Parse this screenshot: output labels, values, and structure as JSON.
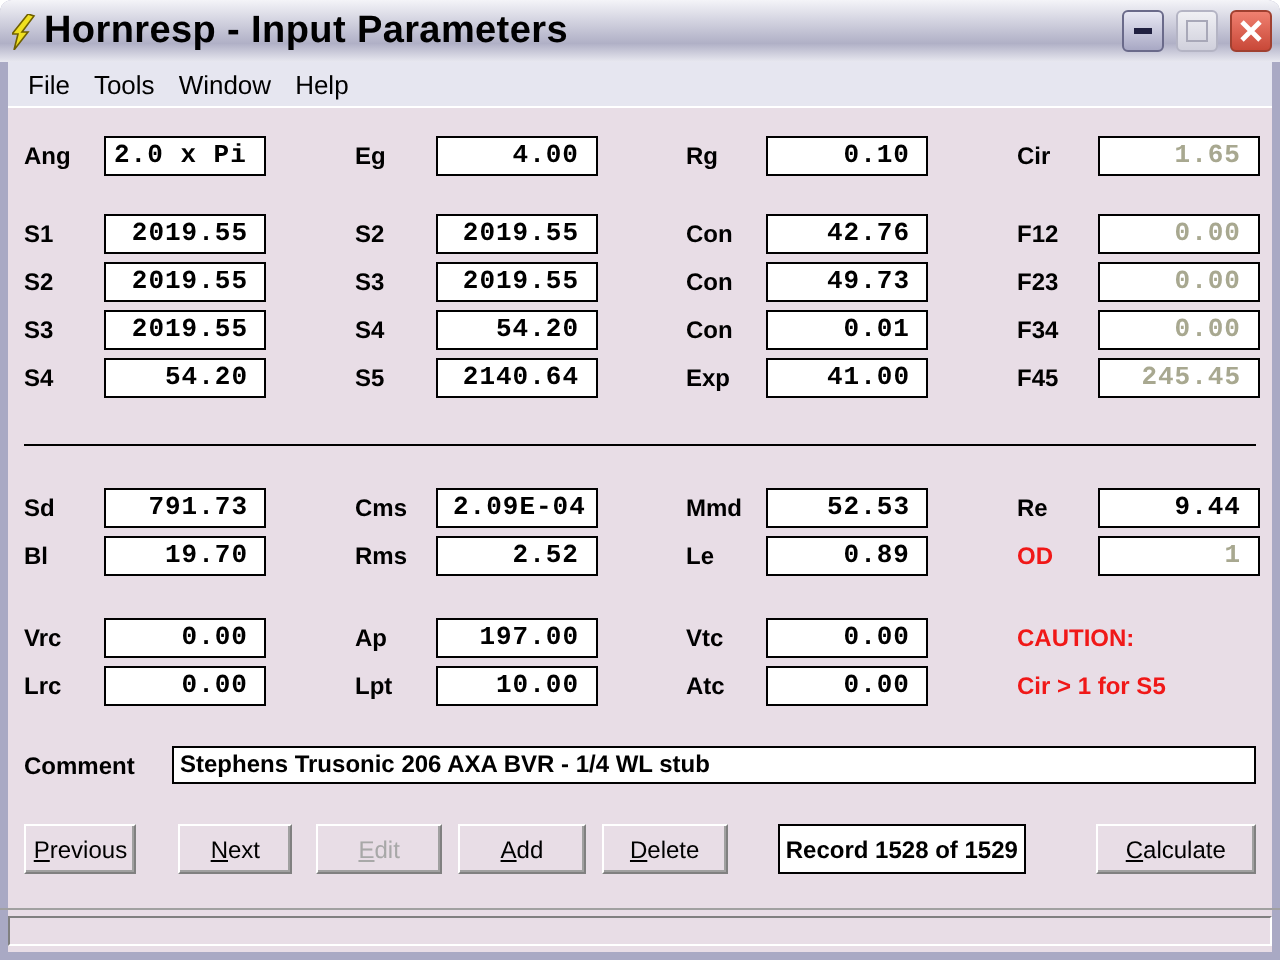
{
  "window": {
    "title": "Hornresp - Input Parameters",
    "controls": [
      {
        "kind": "minimize",
        "disabled": false
      },
      {
        "kind": "maximize",
        "disabled": true
      },
      {
        "kind": "close",
        "disabled": false
      }
    ]
  },
  "menu": [
    "File",
    "Tools",
    "Window",
    "Help"
  ],
  "sections": [
    {
      "rows": [
        [
          {
            "kind": "field",
            "label": "Ang",
            "value": "2.0 x Pi",
            "left_aligned": true,
            "disabled": false,
            "warning": false
          },
          {
            "kind": "field",
            "label": "Eg",
            "value": "4.00",
            "disabled": false,
            "warning": false
          },
          {
            "kind": "field",
            "label": "Rg",
            "value": "0.10",
            "disabled": false,
            "warning": false
          },
          {
            "kind": "field",
            "label": "Cir",
            "value": "1.65",
            "disabled": true,
            "warning": false
          }
        ]
      ]
    },
    {
      "rows": [
        [
          {
            "kind": "field",
            "label": "S1",
            "value": "2019.55",
            "disabled": false,
            "warning": false
          },
          {
            "kind": "field",
            "label": "S2",
            "value": "2019.55",
            "disabled": false,
            "warning": false
          },
          {
            "kind": "field",
            "label": "Con",
            "value": "42.76",
            "disabled": false,
            "warning": false
          },
          {
            "kind": "field",
            "label": "F12",
            "value": "0.00",
            "disabled": true,
            "warning": false
          }
        ],
        [
          {
            "kind": "field",
            "label": "S2",
            "value": "2019.55",
            "disabled": false,
            "warning": false
          },
          {
            "kind": "field",
            "label": "S3",
            "value": "2019.55",
            "disabled": false,
            "warning": false
          },
          {
            "kind": "field",
            "label": "Con",
            "value": "49.73",
            "disabled": false,
            "warning": false
          },
          {
            "kind": "field",
            "label": "F23",
            "value": "0.00",
            "disabled": true,
            "warning": false
          }
        ],
        [
          {
            "kind": "field",
            "label": "S3",
            "value": "2019.55",
            "disabled": false,
            "warning": false
          },
          {
            "kind": "field",
            "label": "S4",
            "value": "54.20",
            "disabled": false,
            "warning": false
          },
          {
            "kind": "field",
            "label": "Con",
            "value": "0.01",
            "disabled": false,
            "warning": false
          },
          {
            "kind": "field",
            "label": "F34",
            "value": "0.00",
            "disabled": true,
            "warning": false
          }
        ],
        [
          {
            "kind": "field",
            "label": "S4",
            "value": "54.20",
            "disabled": false,
            "warning": false
          },
          {
            "kind": "field",
            "label": "S5",
            "value": "2140.64",
            "disabled": false,
            "warning": false
          },
          {
            "kind": "field",
            "label": "Exp",
            "value": "41.00",
            "disabled": false,
            "warning": false
          },
          {
            "kind": "field",
            "label": "F45",
            "value": "245.45",
            "disabled": true,
            "warning": false
          }
        ]
      ]
    },
    {
      "divider": true,
      "rows": [
        [
          {
            "kind": "field",
            "label": "Sd",
            "value": "791.73",
            "disabled": false,
            "warning": false
          },
          {
            "kind": "field",
            "label": "Cms",
            "value": "2.09E-04",
            "disabled": false,
            "warning": false
          },
          {
            "kind": "field",
            "label": "Mmd",
            "value": "52.53",
            "disabled": false,
            "warning": false
          },
          {
            "kind": "field",
            "label": "Re",
            "value": "9.44",
            "disabled": false,
            "warning": false
          }
        ],
        [
          {
            "kind": "field",
            "label": "Bl",
            "value": "19.70",
            "disabled": false,
            "warning": false
          },
          {
            "kind": "field",
            "label": "Rms",
            "value": "2.52",
            "disabled": false,
            "warning": false
          },
          {
            "kind": "field",
            "label": "Le",
            "value": "0.89",
            "disabled": false,
            "warning": false
          },
          {
            "kind": "field",
            "label": "OD",
            "value": "1",
            "disabled": true,
            "warning": true
          }
        ]
      ]
    },
    {
      "rows": [
        [
          {
            "kind": "field",
            "label": "Vrc",
            "value": "0.00",
            "disabled": false,
            "warning": false
          },
          {
            "kind": "field",
            "label": "Ap",
            "value": "197.00",
            "disabled": false,
            "warning": false
          },
          {
            "kind": "field",
            "label": "Vtc",
            "value": "0.00",
            "disabled": false,
            "warning": false
          },
          {
            "kind": "note",
            "text": "CAUTION:",
            "warning": true
          }
        ],
        [
          {
            "kind": "field",
            "label": "Lrc",
            "value": "0.00",
            "disabled": false,
            "warning": false
          },
          {
            "kind": "field",
            "label": "Lpt",
            "value": "10.00",
            "disabled": false,
            "warning": false
          },
          {
            "kind": "field",
            "label": "Atc",
            "value": "0.00",
            "disabled": false,
            "warning": false
          },
          {
            "kind": "note",
            "text": "Cir > 1 for S5",
            "warning": true
          }
        ]
      ]
    }
  ],
  "comment": {
    "label": "Comment",
    "value": "Stephens Trusonic 206 AXA BVR - 1/4 WL stub"
  },
  "buttons": [
    {
      "kind": "button",
      "label": "Previous",
      "disabled": false
    },
    {
      "kind": "button",
      "label": "Next",
      "disabled": false
    },
    {
      "kind": "button",
      "label": "Edit",
      "disabled": true
    },
    {
      "kind": "button",
      "label": "Add",
      "disabled": false
    },
    {
      "kind": "button",
      "label": "Delete",
      "disabled": false
    },
    {
      "kind": "record",
      "label": "Record 1528 of 1529"
    },
    {
      "kind": "button",
      "label": "Calculate",
      "disabled": false
    }
  ]
}
